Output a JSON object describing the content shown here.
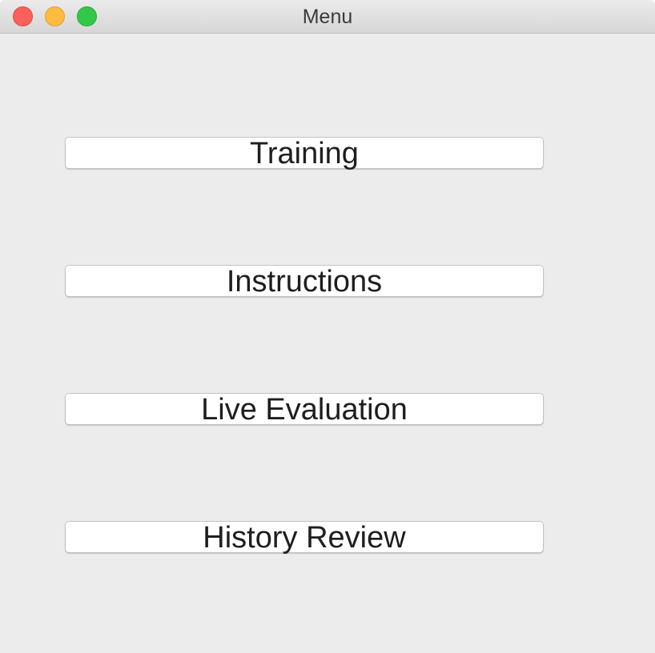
{
  "window": {
    "title": "Menu"
  },
  "titlebar_controls": {
    "close_icon": "close-icon",
    "minimize_icon": "minimize-icon",
    "maximize_icon": "maximize-icon",
    "close_color": "#fc605b",
    "minimize_color": "#fdbc40",
    "maximize_color": "#34c84a"
  },
  "menu": {
    "buttons": [
      {
        "label": "Training"
      },
      {
        "label": "Instructions"
      },
      {
        "label": "Live Evaluation"
      },
      {
        "label": "History Review"
      }
    ]
  }
}
